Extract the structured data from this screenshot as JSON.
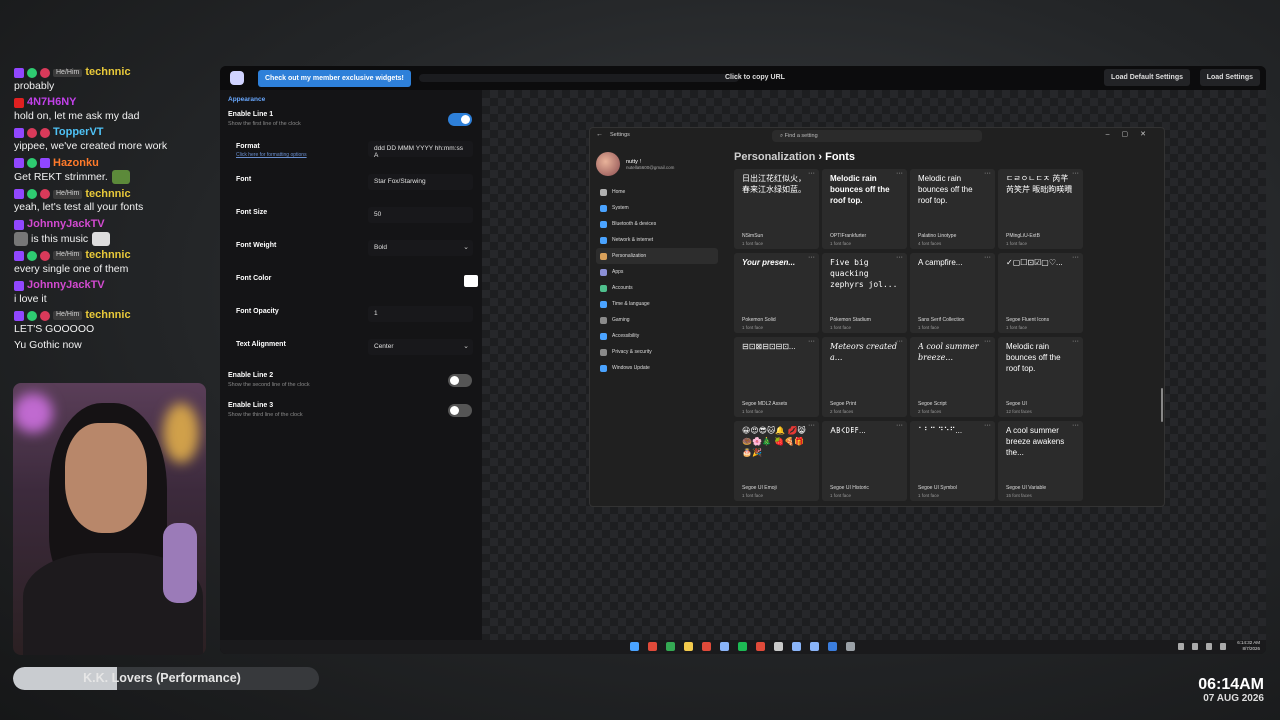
{
  "chat": {
    "messages": [
      {
        "user": "",
        "pronouns": "He/Him",
        "name": "technnic",
        "color": "#e8c93a",
        "text": "probably",
        "badges": [
          "sub",
          "mod",
          "heart"
        ]
      },
      {
        "user": "",
        "pronouns": "",
        "name": "4N7H6NY",
        "color": "#c040e8",
        "text": "hold on, let me ask my dad",
        "badges": [
          "yt"
        ]
      },
      {
        "user": "",
        "pronouns": "",
        "name": "TopperVT",
        "color": "#4fc3f7",
        "text": "yippee, we've created more work",
        "badges": [
          "sub",
          "heart",
          "heart"
        ]
      },
      {
        "user": "",
        "pronouns": "",
        "name": "Hazonku",
        "color": "#ff7a2a",
        "text": "Get REKT strimmer.",
        "badges": [
          "sub",
          "mod",
          "sub"
        ]
      },
      {
        "user": "",
        "pronouns": "He/Him",
        "name": "technnic",
        "color": "#e8c93a",
        "text": "yeah, let's test all your fonts",
        "badges": [
          "sub",
          "mod",
          "heart"
        ]
      },
      {
        "user": "",
        "pronouns": "",
        "name": "JohnnyJackTV",
        "color": "#d24ad0",
        "text": "is this music",
        "badges": [
          "sub"
        ]
      },
      {
        "user": "",
        "pronouns": "He/Him",
        "name": "technnic",
        "color": "#e8c93a",
        "text": "every single one of them",
        "badges": [
          "sub",
          "mod",
          "heart"
        ]
      },
      {
        "user": "",
        "pronouns": "",
        "name": "JohnnyJackTV",
        "color": "#d24ad0",
        "text": "i love it",
        "badges": [
          "sub"
        ]
      },
      {
        "user": "",
        "pronouns": "He/Him",
        "name": "technnic",
        "color": "#e8c93a",
        "text": "LET'S GOOOOO",
        "badges": [
          "sub",
          "mod",
          "heart"
        ]
      },
      {
        "user": "",
        "pronouns": "",
        "name": "",
        "color": "#e8c93a",
        "text": "Yu Gothic now",
        "badges": []
      }
    ]
  },
  "now_playing": {
    "title": "K.K. Lovers (Performance)",
    "progress": 0.34
  },
  "overlay_clock": {
    "time": "06:14AM",
    "date": "07 AUG 2026"
  },
  "topbar": {
    "member_button": "Check out my member exclusive widgets!",
    "copy_url": "Click to copy URL",
    "load_default": "Load Default Settings",
    "load_settings": "Load Settings"
  },
  "settings": {
    "section": "Appearance",
    "enable_line_1": {
      "title": "Enable Line 1",
      "desc": "Show the first line of the clock",
      "on": true
    },
    "fields": [
      {
        "label": "Format",
        "sub": "Click here for formatting options",
        "value": "ddd DD MMM YYYY hh:mm:ss A",
        "kind": "text"
      },
      {
        "label": "Font",
        "sub": "",
        "value": "Star Fox/Starwing",
        "kind": "text"
      },
      {
        "label": "Font Size",
        "sub": "",
        "value": "50",
        "kind": "text"
      },
      {
        "label": "Font Weight",
        "sub": "",
        "value": "Bold",
        "kind": "select"
      },
      {
        "label": "Font Color",
        "sub": "",
        "value": "",
        "kind": "color"
      },
      {
        "label": "Font Opacity",
        "sub": "",
        "value": "1",
        "kind": "text"
      },
      {
        "label": "Text Alignment",
        "sub": "",
        "value": "Center",
        "kind": "select"
      }
    ],
    "enable_line_2": {
      "title": "Enable Line 2",
      "desc": "Show the second line of the clock",
      "on": false
    },
    "enable_line_3": {
      "title": "Enable Line 3",
      "desc": "Show the third line of the clock",
      "on": false
    }
  },
  "win": {
    "title": "Settings",
    "search_placeholder": "Find a setting",
    "profile_name": "nutty !",
    "profile_email": "nutella5600@gmail.com",
    "nav": [
      "Home",
      "System",
      "Bluetooth & devices",
      "Network & internet",
      "Personalization",
      "Apps",
      "Accounts",
      "Time & language",
      "Gaming",
      "Accessibility",
      "Privacy & security",
      "Windows Update"
    ],
    "active_nav": "Personalization",
    "crumb_parent": "Personalization",
    "crumb_sep": "›",
    "crumb_current": "Fonts",
    "fonts": [
      {
        "sample": "日出江花红似火，春来江水绿如蓝。",
        "name": "NSimSun",
        "count": "1 font face"
      },
      {
        "sample": "Melodic rain bounces off the roof top.",
        "name": "OPTIFrankfurter",
        "count": "1 font face"
      },
      {
        "sample": "Melodic rain bounces off the roof top.",
        "name": "Palatino Linotype",
        "count": "4 font faces"
      },
      {
        "sample": "ㄷㄹㅇㄴㄷㅈ 芮芊芮笑芹 畈昢昫暎曊",
        "name": "PMingLiU-ExtB",
        "count": "1 font face"
      },
      {
        "sample": "Your presen...",
        "name": "Pokemon Solid",
        "count": "1 font face"
      },
      {
        "sample": "Five big quacking zephyrs jol...",
        "name": "Pokemon Stadium",
        "count": "1 font face"
      },
      {
        "sample": "A campfire...",
        "name": "Sans Serif Collection",
        "count": "1 font face"
      },
      {
        "sample": "✓▢☐⊡☑▢♡...",
        "name": "Segoe Fluent Icons",
        "count": "1 font face"
      },
      {
        "sample": "⊟⊡⊠⊟⊡⊟⊡...",
        "name": "Segoe MDL2 Assets",
        "count": "1 font face"
      },
      {
        "sample": "Meteors created a...",
        "name": "Segoe Print",
        "count": "2 font faces"
      },
      {
        "sample": "A cool summer breeze...",
        "name": "Segoe Script",
        "count": "2 font faces"
      },
      {
        "sample": "Melodic rain bounces off the roof top.",
        "name": "Segoe UI",
        "count": "12 font faces"
      },
      {
        "sample": "😀😍😎🐱🔔 💋😸🍩🌸🎄 🍓🍕🎁🎂🎉",
        "name": "Segoe UI Emoji",
        "count": "1 font face"
      },
      {
        "sample": "𐌀𐌁𐌂𐌃𐌄𐌅...",
        "name": "Segoe UI Historic",
        "count": "1 font face"
      },
      {
        "sample": "⠁⠃⠉ ⠙⠑⠋...",
        "name": "Segoe UI Symbol",
        "count": "1 font face"
      },
      {
        "sample": "A cool summer breeze awakens the...",
        "name": "Segoe UI Variable",
        "count": "15 font faces"
      }
    ]
  },
  "taskbar": {
    "icon_colors": [
      "#4aa3ff",
      "#e04a3a",
      "#34a853",
      "#f2c94c",
      "#e04a3a",
      "#8ab4f8",
      "#1db954",
      "#e04a3a",
      "#c8c8c8",
      "#8ab4f8",
      "#8ab4f8",
      "#3b7ddd",
      "#9aa0a6"
    ],
    "time": "6:14:32 AM",
    "date": "8/7/2026"
  },
  "colors": {
    "accent": "#2e80d9",
    "link": "#68a8ff"
  }
}
